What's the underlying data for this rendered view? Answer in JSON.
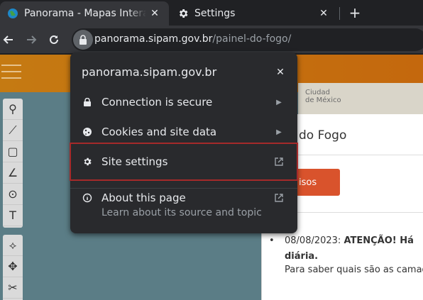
{
  "tabs": [
    {
      "title": "Panorama - Mapas Interativos",
      "active": true
    },
    {
      "title": "Settings",
      "active": false
    }
  ],
  "toolbar": {
    "url_host": "panorama.sipam.gov.br",
    "url_path": "/painel-do-fogo/"
  },
  "popup": {
    "title": "panorama.sipam.gov.br",
    "items": [
      {
        "label": "Connection is secure",
        "icon": "lock-icon",
        "trailing": "chevron-right-icon"
      },
      {
        "label": "Cookies and site data",
        "icon": "cookie-icon",
        "trailing": "chevron-right-icon"
      },
      {
        "label": "Site settings",
        "icon": "gear-icon",
        "trailing": "open-external-icon",
        "highlighted": true
      },
      {
        "label": "About this page",
        "sublabel": "Learn about its source and topic",
        "icon": "page-info-icon",
        "trailing": "open-external-icon"
      }
    ],
    "highlight_color": "#a52a2a"
  },
  "page": {
    "map_label_1": "Ciudad",
    "map_label_2": "de México",
    "panel_title": "do Fogo",
    "panel_button": "isos",
    "notice_date": "08/08/2023:",
    "notice_bold": "ATENÇÃO! Há",
    "notice_bold2": "diária.",
    "notice_text": "Para saber quais são as camad"
  },
  "colors": {
    "orange_bar": "#c57a12",
    "map_sea": "#5b7d86",
    "button": "#d9532c"
  }
}
